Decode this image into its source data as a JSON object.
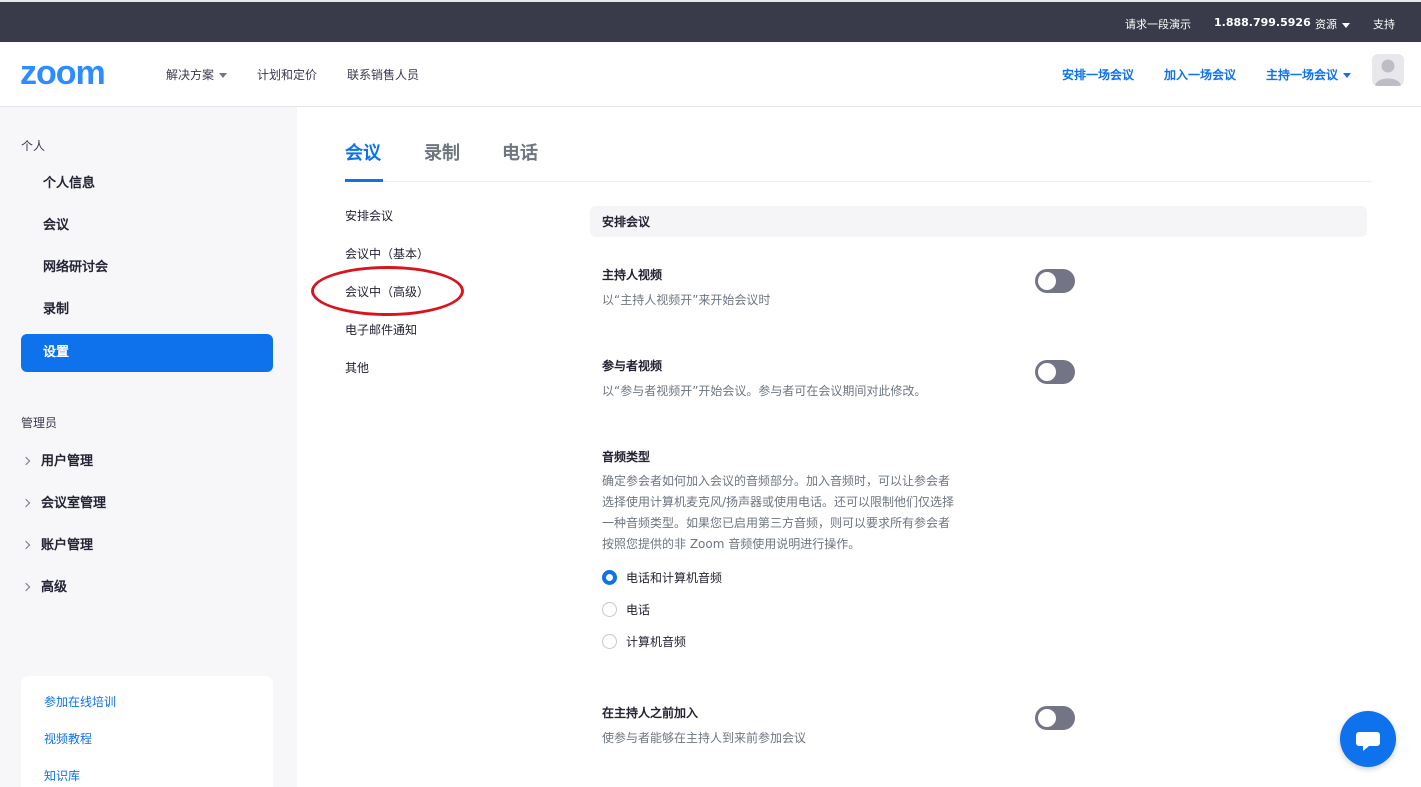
{
  "topbar": {
    "request_demo": "请求一段演示",
    "phone": "1.888.799.5926",
    "resources": "资源",
    "support": "支持"
  },
  "header": {
    "logo": "zoom",
    "nav": {
      "solutions": "解决方案",
      "plans": "计划和定价",
      "contact_sales": "联系销售人员"
    },
    "actions": {
      "schedule": "安排一场会议",
      "join": "加入一场会议",
      "host": "主持一场会议"
    }
  },
  "sidebar": {
    "personal_title": "个人",
    "personal_items": [
      "个人信息",
      "会议",
      "网络研讨会",
      "录制",
      "设置"
    ],
    "admin_title": "管理员",
    "admin_items": [
      "用户管理",
      "会议室管理",
      "账户管理",
      "高级"
    ],
    "help_links": [
      "参加在线培训",
      "视频教程",
      "知识库"
    ]
  },
  "tabs": [
    "会议",
    "录制",
    "电话"
  ],
  "subnav": [
    "安排会议",
    "会议中（基本）",
    "会议中（高级）",
    "电子邮件通知",
    "其他"
  ],
  "section": {
    "title": "安排会议",
    "host_video": {
      "title": "主持人视频",
      "desc": "以“主持人视频开”来开始会议时",
      "enabled": false
    },
    "participant_video": {
      "title": "参与者视频",
      "desc": "以“参与者视频开”开始会议。参与者可在会议期间对此修改。",
      "enabled": false
    },
    "audio_type": {
      "title": "音频类型",
      "desc": [
        "确定参会者如何加入会议的音频部分。加入音频时，可以让参会者",
        "选择使用计算机麦克风/扬声器或使用电话。还可以限制他们仅选择",
        "一种音频类型。如果您已启用第三方音频，则可以要求所有参会者",
        "按照您提供的非 Zoom 音频使用说明进行操作。"
      ],
      "options": [
        "电话和计算机音频",
        "电话",
        "计算机音频"
      ],
      "selected": "电话和计算机音频"
    },
    "join_before_host": {
      "title": "在主持人之前加入",
      "desc": "使参与者能够在主持人到来前参加会议",
      "enabled": false
    }
  },
  "colors": {
    "accent": "#0e72ed",
    "topbar": "#3a3b4a",
    "toggle_off": "#747487",
    "annotation": "#d8151f"
  }
}
